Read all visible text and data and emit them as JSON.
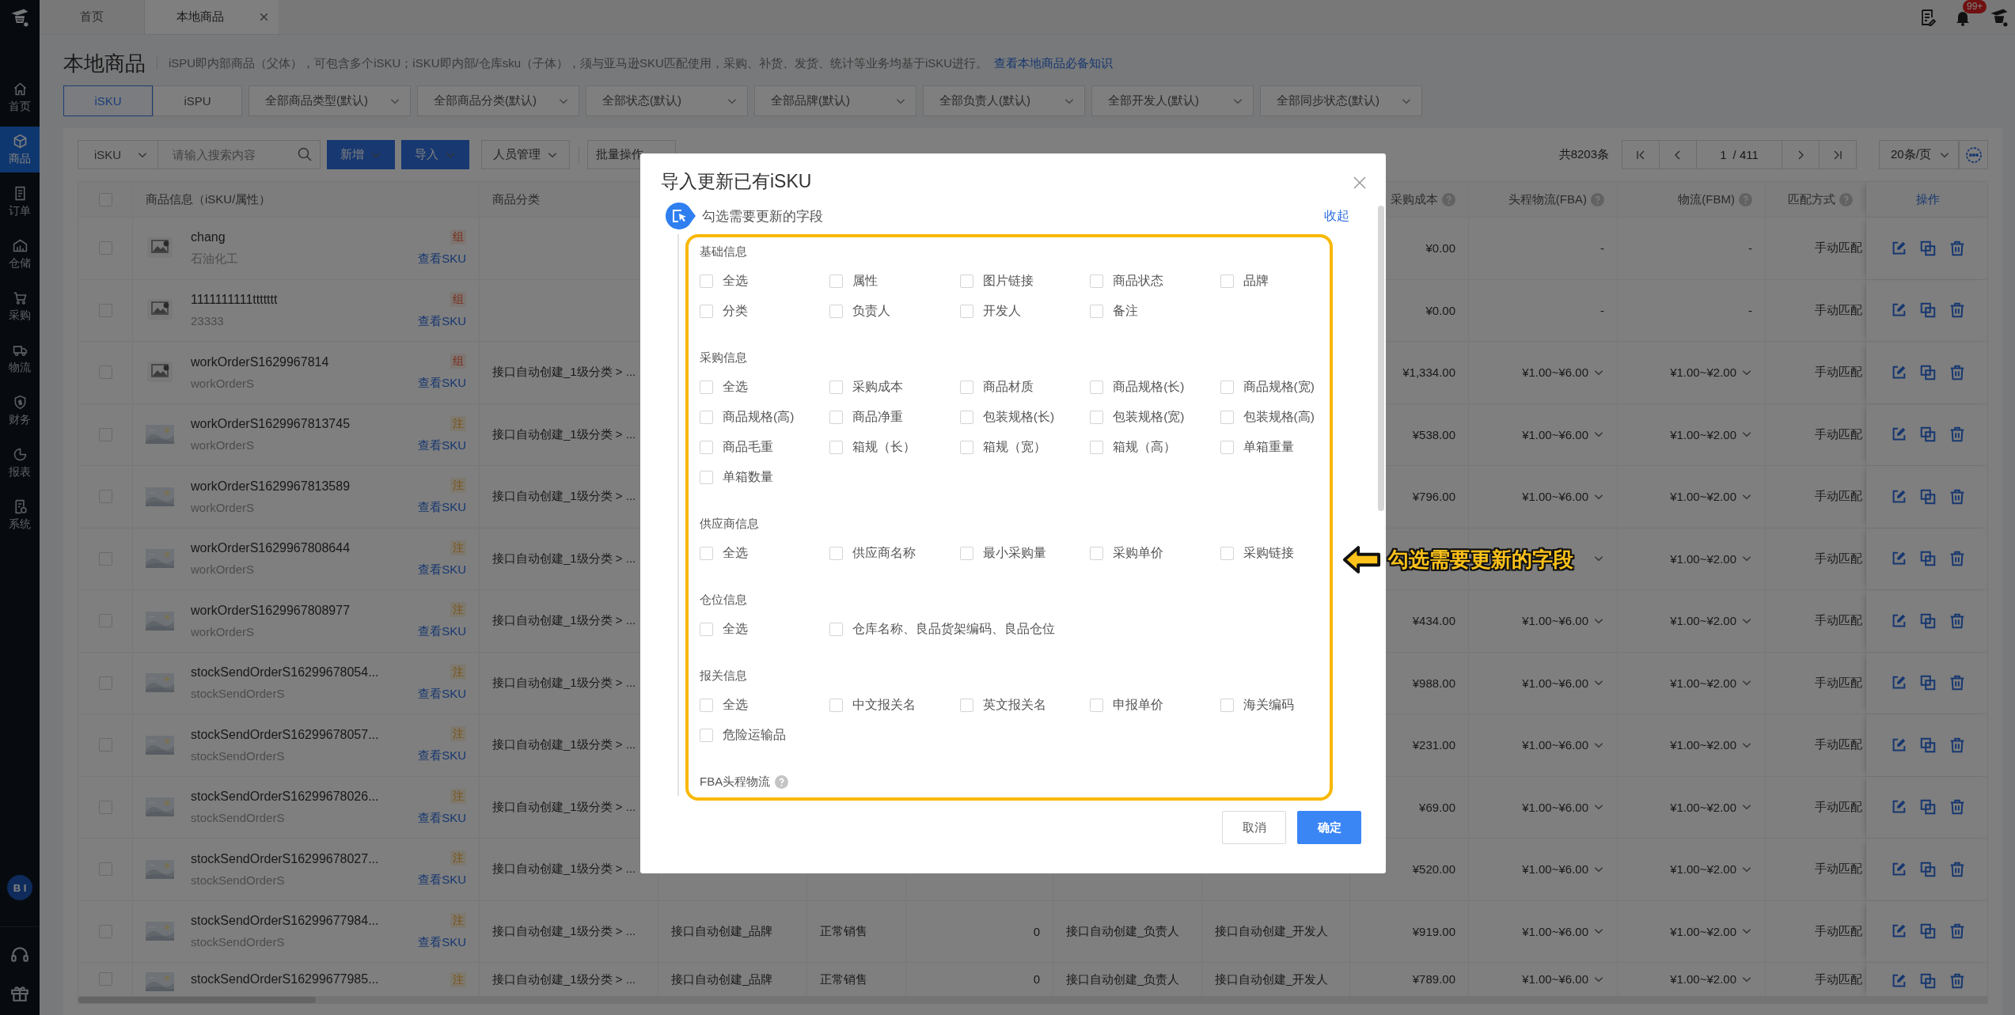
{
  "sidebar": {
    "items": [
      {
        "label": "首页",
        "kind": "home",
        "selected": false
      },
      {
        "label": "商品",
        "kind": "product",
        "selected": true
      },
      {
        "label": "订单",
        "kind": "order",
        "selected": false
      },
      {
        "label": "仓储",
        "kind": "warehouse",
        "selected": false
      },
      {
        "label": "采购",
        "kind": "purchase",
        "selected": false
      },
      {
        "label": "物流",
        "kind": "logistics",
        "selected": false
      },
      {
        "label": "财务",
        "kind": "finance",
        "selected": false
      },
      {
        "label": "报表",
        "kind": "report",
        "selected": false
      },
      {
        "label": "系统",
        "kind": "system",
        "selected": false
      }
    ],
    "avatar": "B I"
  },
  "tabs": [
    {
      "label": "首页",
      "selected": false,
      "closable": false
    },
    {
      "label": "本地商品",
      "selected": true,
      "closable": true
    }
  ],
  "notifications": {
    "badge": "99+"
  },
  "page": {
    "title": "本地商品",
    "description": "iSPU即内部商品（父体），可包含多个iSKU；iSKU即内部/仓库sku（子体），须与亚马逊SKU匹配使用，采购、补货、发货、统计等业务均基于iSKU进行。",
    "link": "查看本地商品必备知识"
  },
  "view_switch": [
    {
      "label": "iSKU",
      "selected": true
    },
    {
      "label": "iSPU",
      "selected": false
    }
  ],
  "filters": [
    "全部商品类型(默认)",
    "全部商品分类(默认)",
    "全部状态(默认)",
    "全部品牌(默认)",
    "全部负责人(默认)",
    "全部开发人(默认)",
    "全部同步状态(默认)"
  ],
  "toolbar": {
    "search_type": "iSKU",
    "search_placeholder": "请输入搜索内容",
    "buttons": [
      {
        "label": "新增",
        "kind": "primary",
        "dropdown": true
      },
      {
        "label": "导入",
        "kind": "primary",
        "dropdown": true
      },
      {
        "label": "人员管理",
        "kind": "default",
        "dropdown": true
      },
      {
        "label": "批量操作",
        "kind": "default",
        "dropdown": false
      }
    ],
    "total": "共8203条",
    "page": "1",
    "page_count": "/ 411",
    "page_size": "20条/页"
  },
  "table": {
    "select_all": {
      "checked": false
    },
    "columns": [
      {
        "label": "商品信息（iSKU/属性）"
      },
      {
        "label": "商品分类"
      },
      {
        "label": "采购成本",
        "help": true
      },
      {
        "label": "头程物流(FBA)",
        "help": true
      },
      {
        "label": "物流(FBM)",
        "help": true
      },
      {
        "label": "匹配方式",
        "help": true
      },
      {
        "label": "操作"
      }
    ],
    "rows": [
      {
        "checked": false,
        "thumb": {
          "kind": "placeholder"
        },
        "sku": "chang",
        "attribute": "石油化工",
        "tag": {
          "text": "组",
          "kind": "combo"
        },
        "link": "查看SKU",
        "cost": "¥0.00",
        "fba": {
          "text": "-",
          "dropdown": false
        },
        "fbm": {
          "text": "-",
          "dropdown": false
        },
        "match": "手动匹配"
      },
      {
        "checked": false,
        "thumb": {
          "kind": "placeholder"
        },
        "sku": "1111111111ttttttt",
        "attribute": "23333",
        "tag": {
          "text": "组",
          "kind": "combo"
        },
        "link": "查看SKU",
        "cost": "¥0.00",
        "fba": {
          "text": "-",
          "dropdown": false
        },
        "fbm": {
          "text": "-",
          "dropdown": false
        },
        "match": "手动匹配"
      },
      {
        "checked": false,
        "thumb": {
          "kind": "placeholder"
        },
        "sku": "workOrderS1629967814",
        "attribute": "workOrderS",
        "tag": {
          "text": "组",
          "kind": "combo"
        },
        "link": "查看SKU",
        "category": "接口自动创建_1级分类 > ...",
        "cost": "¥1,334.00",
        "fba": {
          "text": "¥1.00~¥6.00",
          "dropdown": true
        },
        "fbm": {
          "text": "¥1.00~¥2.00",
          "dropdown": true
        },
        "match": "手动匹配"
      },
      {
        "checked": false,
        "sku": "workOrderS1629967813745",
        "attribute": "workOrderS",
        "tag": {
          "text": "注",
          "kind": "note"
        },
        "link": "查看SKU",
        "category": "接口自动创建_1级分类 > ...",
        "cost": "¥538.00",
        "fba": {
          "text": "¥1.00~¥6.00",
          "dropdown": true
        },
        "fbm": {
          "text": "¥1.00~¥2.00",
          "dropdown": true
        },
        "match": "手动匹配"
      },
      {
        "checked": false,
        "sku": "workOrderS1629967813589",
        "attribute": "workOrderS",
        "tag": {
          "text": "注",
          "kind": "note"
        },
        "link": "查看SKU",
        "category": "接口自动创建_1级分类 > ...",
        "cost": "¥796.00",
        "fba": {
          "text": "¥1.00~¥6.00",
          "dropdown": true
        },
        "fbm": {
          "text": "¥1.00~¥2.00",
          "dropdown": true
        },
        "match": "手动匹配"
      },
      {
        "checked": false,
        "sku": "workOrderS1629967808644",
        "attribute": "workOrderS",
        "tag": {
          "text": "注",
          "kind": "note"
        },
        "link": "查看SKU",
        "category": "接口自动创建_1级分类 > ...",
        "fba": {
          "dropdown": true
        },
        "fbm": {
          "text": "¥1.00~¥2.00",
          "dropdown": true
        },
        "match": "手动匹配"
      },
      {
        "checked": false,
        "sku": "workOrderS1629967808977",
        "attribute": "workOrderS",
        "tag": {
          "text": "注",
          "kind": "note"
        },
        "link": "查看SKU",
        "category": "接口自动创建_1级分类 > ...",
        "cost": "¥434.00",
        "fba": {
          "text": "¥1.00~¥6.00",
          "dropdown": true
        },
        "fbm": {
          "text": "¥1.00~¥2.00",
          "dropdown": true
        },
        "match": "手动匹配"
      },
      {
        "checked": false,
        "sku": "stockSendOrderS16299678054...",
        "attribute": "stockSendOrderS",
        "tag": {
          "text": "注",
          "kind": "note"
        },
        "link": "查看SKU",
        "category": "接口自动创建_1级分类 > ...",
        "cost": "¥988.00",
        "fba": {
          "text": "¥1.00~¥6.00",
          "dropdown": true
        },
        "fbm": {
          "text": "¥1.00~¥2.00",
          "dropdown": true
        },
        "match": "手动匹配"
      },
      {
        "checked": false,
        "sku": "stockSendOrderS16299678057...",
        "attribute": "stockSendOrderS",
        "tag": {
          "text": "注",
          "kind": "note"
        },
        "link": "查看SKU",
        "category": "接口自动创建_1级分类 > ...",
        "cost": "¥231.00",
        "fba": {
          "text": "¥1.00~¥6.00",
          "dropdown": true
        },
        "fbm": {
          "text": "¥1.00~¥2.00",
          "dropdown": true
        },
        "match": "手动匹配"
      },
      {
        "checked": false,
        "sku": "stockSendOrderS16299678026...",
        "attribute": "stockSendOrderS",
        "tag": {
          "text": "注",
          "kind": "note"
        },
        "link": "查看SKU",
        "category": "接口自动创建_1级分类 > ...",
        "cost": "¥69.00",
        "fba": {
          "text": "¥1.00~¥6.00",
          "dropdown": true
        },
        "fbm": {
          "text": "¥1.00~¥2.00",
          "dropdown": true
        },
        "match": "手动匹配"
      },
      {
        "checked": false,
        "sku": "stockSendOrderS16299678027...",
        "attribute": "stockSendOrderS",
        "tag": {
          "text": "注",
          "kind": "note"
        },
        "link": "查看SKU",
        "category": "接口自动创建_1级分类 > ...",
        "cost": "¥520.00",
        "fba": {
          "text": "¥1.00~¥6.00",
          "dropdown": true
        },
        "fbm": {
          "text": "¥1.00~¥2.00",
          "dropdown": true
        },
        "match": "手动匹配"
      },
      {
        "checked": false,
        "sku": "stockSendOrderS16299677984...",
        "attribute": "stockSendOrderS",
        "tag": {
          "text": "注",
          "kind": "note"
        },
        "link": "查看SKU",
        "category": "接口自动创建_1级分类 > ...",
        "column_4": "接口自动创建_品牌",
        "column_5": "正常销售",
        "column_6": "0",
        "column_7": "接口自动创建_负责人",
        "column_8": "接口自动创建_开发人",
        "cost": "¥919.00",
        "fba": {
          "text": "¥1.00~¥6.00",
          "dropdown": true
        },
        "fbm": {
          "text": "¥1.00~¥2.00",
          "dropdown": true
        },
        "match": "手动匹配"
      },
      {
        "checked": false,
        "sku": "stockSendOrderS16299677985...",
        "tag": {
          "text": "注",
          "kind": "note"
        },
        "category": "接口自动创建_1级分类 > ...",
        "column_4": "接口自动创建_品牌",
        "column_5": "正常销售",
        "column_6": "0",
        "column_7": "接口自动创建_负责人",
        "column_8": "接口自动创建_开发人",
        "cost": "¥789.00",
        "fba": {
          "text": "¥1.00~¥6.00",
          "dropdown": true
        },
        "fbm": {
          "text": "¥1.00~¥2.00",
          "dropdown": true
        },
        "match": "手动匹配"
      }
    ]
  },
  "modal": {
    "title": "导入更新已有iSKU",
    "step": "勾选需要更新的字段",
    "collapse": "收起",
    "groups": [
      {
        "title": "基础信息",
        "options": [
          {
            "label": "全选",
            "checked": false
          },
          {
            "label": "属性",
            "checked": false
          },
          {
            "label": "图片链接",
            "checked": false
          },
          {
            "label": "商品状态",
            "checked": false
          },
          {
            "label": "品牌",
            "checked": false
          },
          {
            "label": "分类",
            "checked": false
          },
          {
            "label": "负责人",
            "checked": false
          },
          {
            "label": "开发人",
            "checked": false
          },
          {
            "label": "备注",
            "checked": false
          }
        ]
      },
      {
        "title": "采购信息",
        "options": [
          {
            "label": "全选",
            "checked": false
          },
          {
            "label": "采购成本",
            "checked": false
          },
          {
            "label": "商品材质",
            "checked": false
          },
          {
            "label": "商品规格(长)",
            "checked": false
          },
          {
            "label": "商品规格(宽)",
            "checked": false
          },
          {
            "label": "商品规格(高)",
            "checked": false
          },
          {
            "label": "商品净重",
            "checked": false
          },
          {
            "label": "包装规格(长)",
            "checked": false
          },
          {
            "label": "包装规格(宽)",
            "checked": false
          },
          {
            "label": "包装规格(高)",
            "checked": false
          },
          {
            "label": "商品毛重",
            "checked": false
          },
          {
            "label": "箱规（长）",
            "checked": false
          },
          {
            "label": "箱规（宽）",
            "checked": false
          },
          {
            "label": "箱规（高）",
            "checked": false
          },
          {
            "label": "单箱重量",
            "checked": false
          },
          {
            "label": "单箱数量",
            "checked": false
          }
        ]
      },
      {
        "title": "供应商信息",
        "options": [
          {
            "label": "全选",
            "checked": false
          },
          {
            "label": "供应商名称",
            "checked": false
          },
          {
            "label": "最小采购量",
            "checked": false
          },
          {
            "label": "采购单价",
            "checked": false
          },
          {
            "label": "采购链接",
            "checked": false
          }
        ]
      },
      {
        "title": "仓位信息",
        "options": [
          {
            "label": "全选",
            "checked": false
          },
          {
            "label": "仓库名称、良品货架编码、良品仓位",
            "checked": false
          }
        ]
      },
      {
        "title": "报关信息",
        "options": [
          {
            "label": "全选",
            "checked": false
          },
          {
            "label": "中文报关名",
            "checked": false
          },
          {
            "label": "英文报关名",
            "checked": false
          },
          {
            "label": "申报单价",
            "checked": false
          },
          {
            "label": "海关编码",
            "checked": false
          },
          {
            "label": "危险运输品",
            "checked": false
          }
        ]
      },
      {
        "title": "FBA头程物流",
        "help": true
      }
    ],
    "buttons": [
      {
        "label": "取消",
        "kind": "default"
      },
      {
        "label": "确定",
        "kind": "primary"
      }
    ]
  },
  "callout": {
    "text": "勾选需要更新的字段"
  }
}
